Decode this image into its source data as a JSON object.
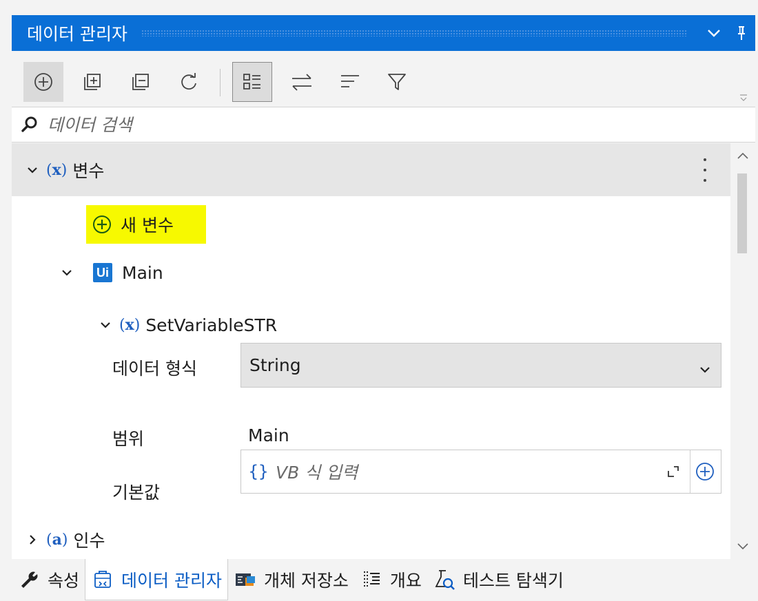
{
  "panel": {
    "title": "데이터 관리자",
    "collapse_icon": "chevron-down-icon",
    "pin_icon": "pin-icon"
  },
  "toolbar": {
    "buttons": [
      {
        "name": "add-icon"
      },
      {
        "name": "expand-all-icon"
      },
      {
        "name": "collapse-all-icon"
      },
      {
        "name": "refresh-icon"
      },
      {
        "name": "list-view-icon"
      },
      {
        "name": "swap-icon"
      },
      {
        "name": "sort-icon"
      },
      {
        "name": "filter-icon"
      }
    ]
  },
  "search": {
    "placeholder": "데이터 검색"
  },
  "tree": {
    "variables_label": "변수",
    "variables_badge_symbol": "x",
    "new_variable_label": "새 변수",
    "workflow_badge": "Ui",
    "workflow_label": "Main",
    "variable_name": "SetVariableSTR",
    "props": {
      "type_label": "데이터 형식",
      "type_value": "String",
      "scope_label": "범위",
      "scope_value": "Main",
      "default_label": "기본값",
      "default_brace": "{}",
      "default_placeholder": "VB 식 입력"
    },
    "arguments_label": "인수",
    "arguments_badge_symbol": "a"
  },
  "tabs": [
    {
      "label": "속성",
      "icon": "wrench-icon",
      "active": false
    },
    {
      "label": "데이터 관리자",
      "icon": "data-manager-icon",
      "active": true
    },
    {
      "label": "개체 저장소",
      "icon": "object-repository-icon",
      "active": false
    },
    {
      "label": "개요",
      "icon": "outline-icon",
      "active": false
    },
    {
      "label": "테스트 탐색기",
      "icon": "test-explorer-icon",
      "active": false
    }
  ],
  "colors": {
    "accent": "#0a6fd6",
    "highlight": "#f7f900",
    "badge_blue": "#1976d2"
  }
}
